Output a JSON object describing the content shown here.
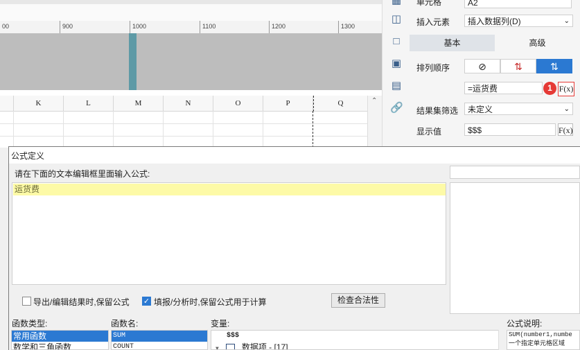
{
  "ruler": {
    "ticks": [
      "00",
      "900",
      "1000",
      "1100",
      "1200",
      "1300"
    ]
  },
  "grid": {
    "columns": [
      "K",
      "L",
      "M",
      "N",
      "O",
      "P",
      "Q"
    ]
  },
  "props": {
    "cell_label": "单元格",
    "cell_value": "A2",
    "insert_label": "插入元素",
    "insert_value": "插入数据列(D)",
    "tab_basic": "基本",
    "tab_advanced": "高级",
    "sort_label": "排列顺序",
    "sort_value": "=运货费",
    "badge": "1",
    "filter_label": "结果集筛选",
    "filter_value": "未定义",
    "display_label": "显示值",
    "display_value": "$$$",
    "fx": "F(x)"
  },
  "dialog": {
    "title": "公式定义",
    "prompt": "请在下面的文本编辑框里面输入公式:",
    "formula": "运货费",
    "keep_export": "导出/编辑结果时,保留公式",
    "keep_fill": "填报/分析时,保留公式用于计算",
    "check_button": "检查合法性",
    "func_type_label": "函数类型:",
    "func_name_label": "函数名:",
    "var_label": "变量:",
    "desc_label": "公式说明:",
    "func_types": [
      "常用函数",
      "数学和三角函数"
    ],
    "func_names": [
      "SUM",
      "COUNT"
    ],
    "variables": [
      "$$$",
      "数据项 - [17]"
    ],
    "desc_lines": [
      "SUM(number1,numbe",
      "一个指定单元格区域"
    ]
  },
  "colors": {
    "accent": "#2b79d2",
    "highlight": "#fdfaa7",
    "badge": "#e53935"
  }
}
